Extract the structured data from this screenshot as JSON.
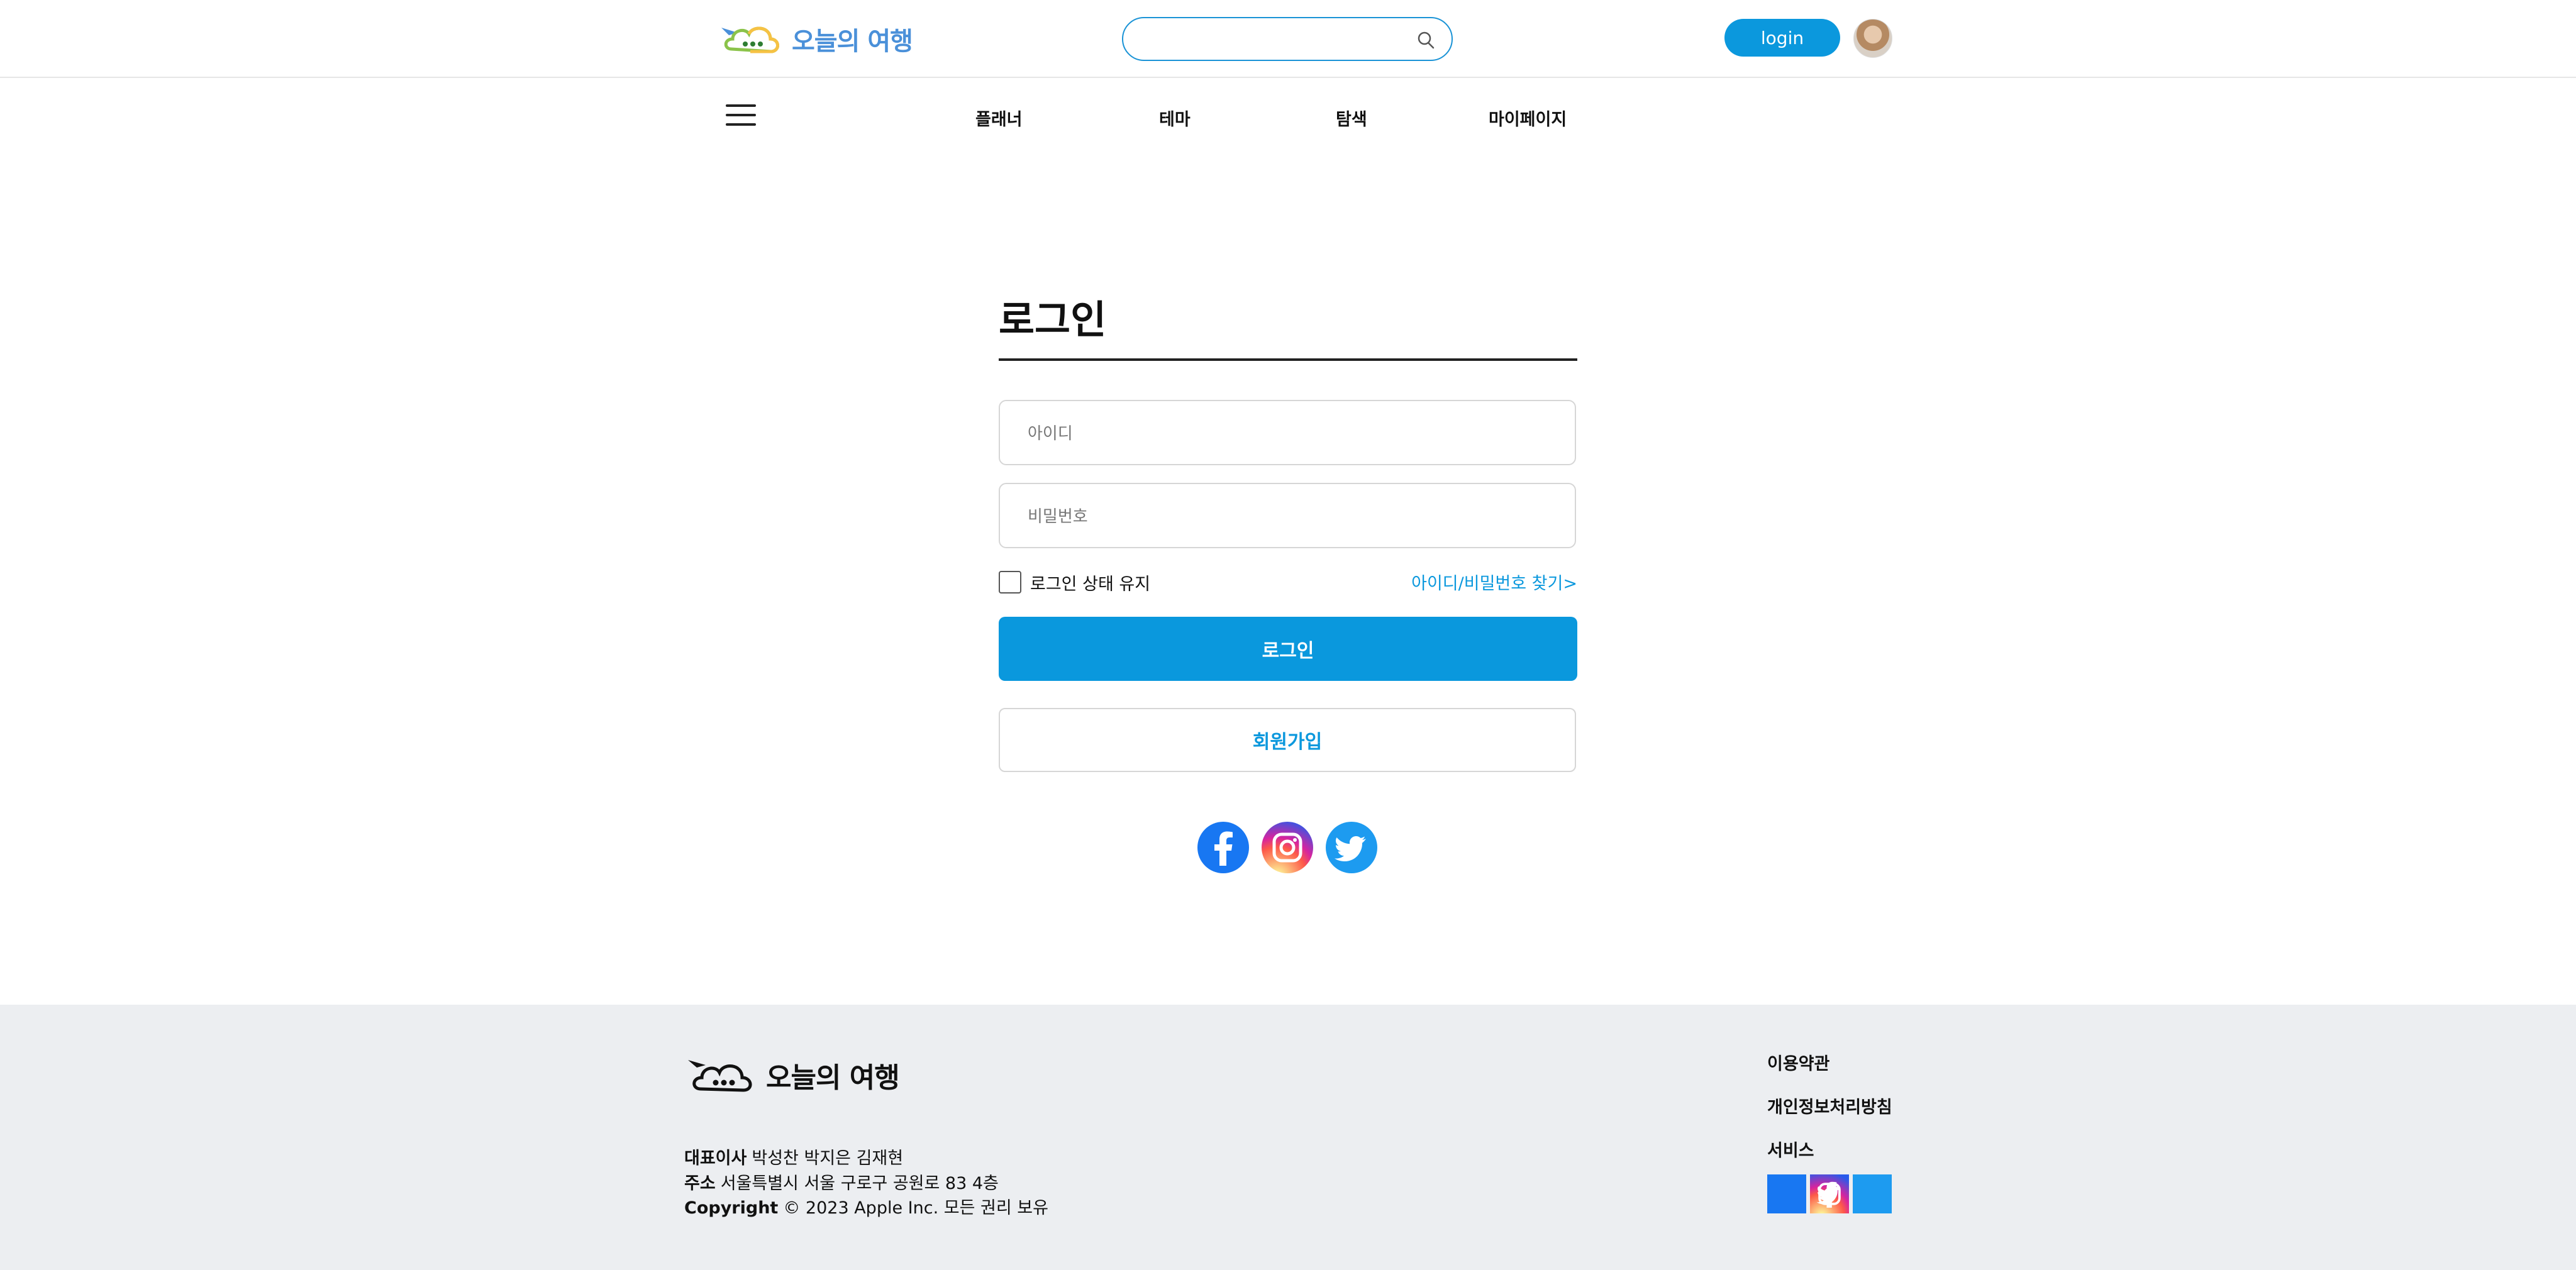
{
  "header": {
    "logo_text": "오늘의 여행",
    "search_placeholder": "",
    "login_label": "login"
  },
  "nav": {
    "items": [
      {
        "label": "플래너"
      },
      {
        "label": "테마"
      },
      {
        "label": "탐색"
      },
      {
        "label": "마이페이지"
      }
    ]
  },
  "login": {
    "title": "로그인",
    "id_placeholder": "아이디",
    "password_placeholder": "비밀번호",
    "keep_label": "로그인 상태 유지",
    "find_label": "아이디/비밀번호 찾기>",
    "submit_label": "로그인",
    "signup_label": "회원가입"
  },
  "social": [
    {
      "name": "facebook-icon",
      "color": "#1877f2"
    },
    {
      "name": "instagram-icon",
      "color": "#d6249f"
    },
    {
      "name": "twitter-icon",
      "color": "#1d9bf0"
    }
  ],
  "footer": {
    "logo_text": "오늘의 여행",
    "ceo_label": "대표이사",
    "ceo_value": "박성찬 박지은 김재현",
    "address_label": "주소",
    "address_value": "서울특별시 서울 구로구 공원로 83 4층",
    "copyright_label": "Copyright",
    "copyright_value": "© 2023 Apple Inc. 모든 권리 보유",
    "links": [
      {
        "label": "이용약관"
      },
      {
        "label": "개인정보처리방침"
      },
      {
        "label": "서비스"
      }
    ]
  },
  "colors": {
    "accent": "#0b98dd",
    "footer_bg": "#eceef1"
  }
}
